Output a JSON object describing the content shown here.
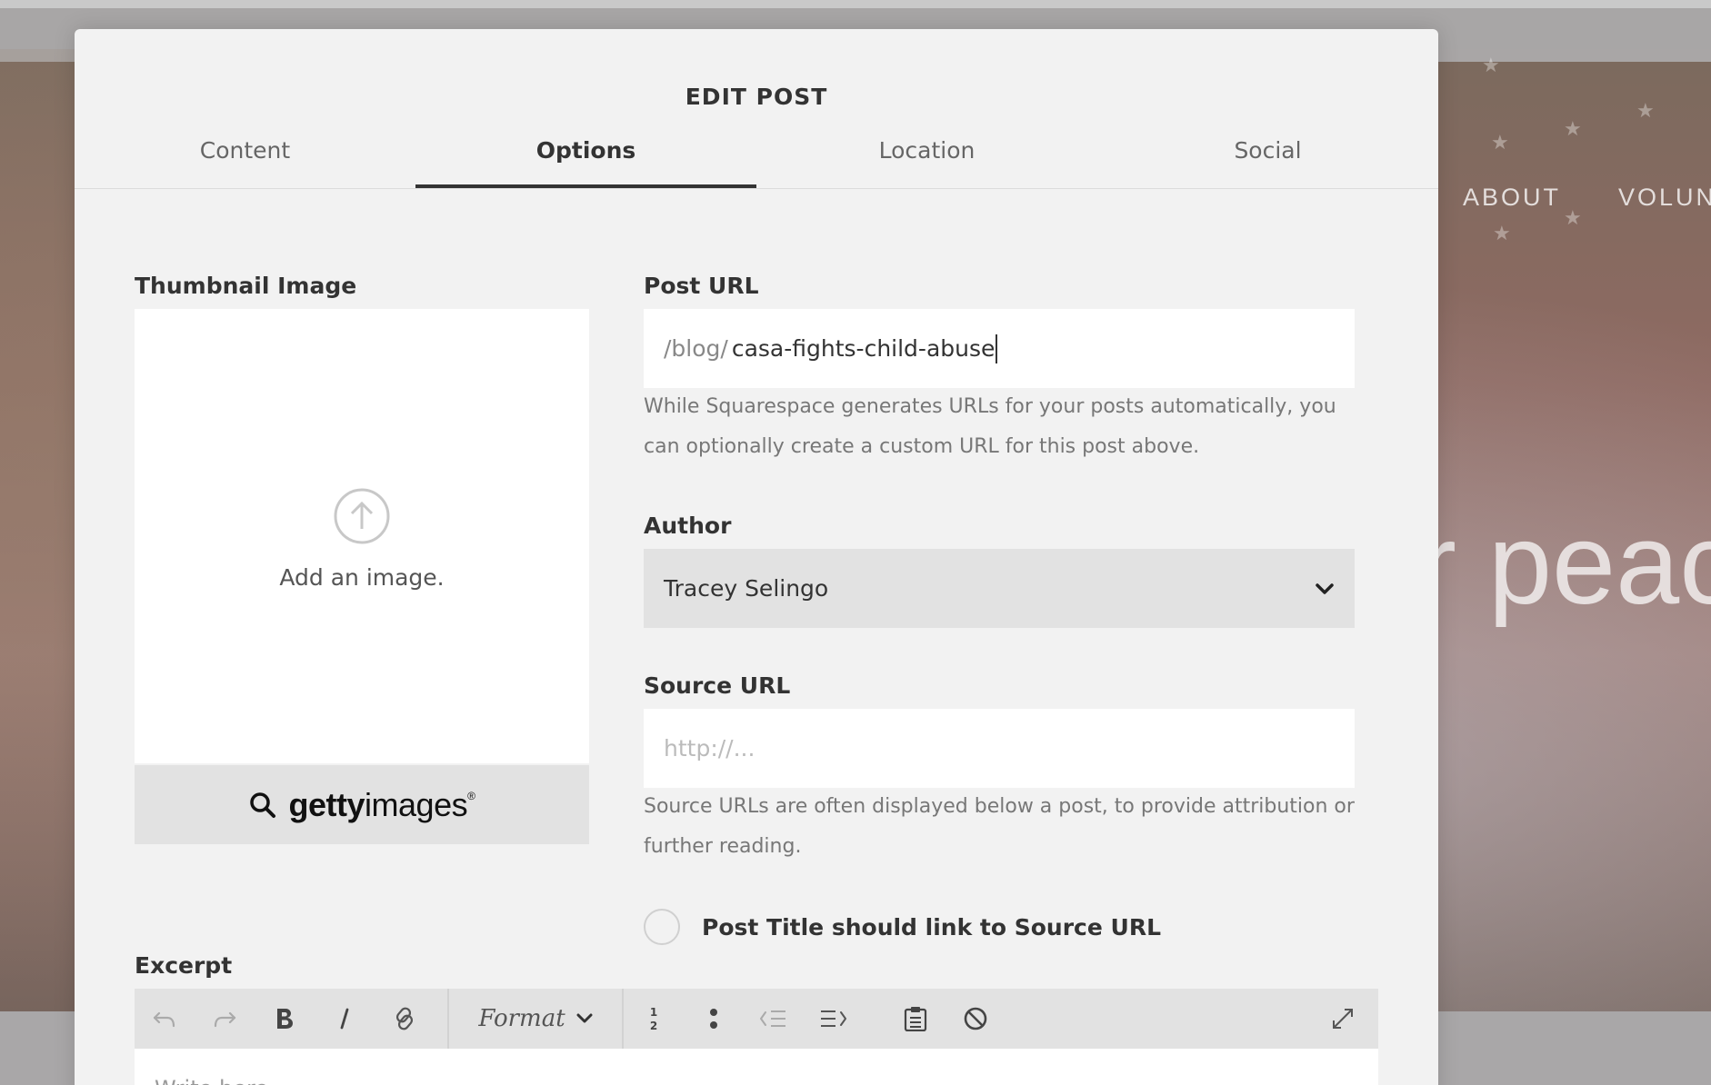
{
  "background": {
    "nav_items": [
      "ABOUT",
      "VOLUN"
    ],
    "hero_text": "r peac"
  },
  "modal": {
    "title": "EDIT POST",
    "tabs": [
      {
        "label": "Content",
        "active": false
      },
      {
        "label": "Options",
        "active": true
      },
      {
        "label": "Location",
        "active": false
      },
      {
        "label": "Social",
        "active": false
      }
    ]
  },
  "thumbnail": {
    "label": "Thumbnail Image",
    "add_text": "Add an image.",
    "getty_brand_bold": "getty",
    "getty_brand_light": "images",
    "getty_reg": "®"
  },
  "post_url": {
    "label": "Post URL",
    "prefix": "/blog/",
    "value": "casa-fights-child-abuse",
    "help": "While Squarespace generates URLs for your posts automatically, you can optionally create a custom URL for this post above."
  },
  "author": {
    "label": "Author",
    "selected": "Tracey Selingo"
  },
  "source_url": {
    "label": "Source URL",
    "placeholder": "http://...",
    "help": "Source URLs are often displayed below a post, to provide attribution or further reading."
  },
  "link_option": {
    "label": "Post Title should link to Source URL",
    "checked": false
  },
  "excerpt": {
    "label": "Excerpt",
    "format_label": "Format",
    "placeholder": "Write here..."
  },
  "colors": {
    "modal_bg": "#f2f2f2",
    "text_primary": "#333333",
    "text_muted": "#777777",
    "select_bg": "#e2e2e2"
  }
}
